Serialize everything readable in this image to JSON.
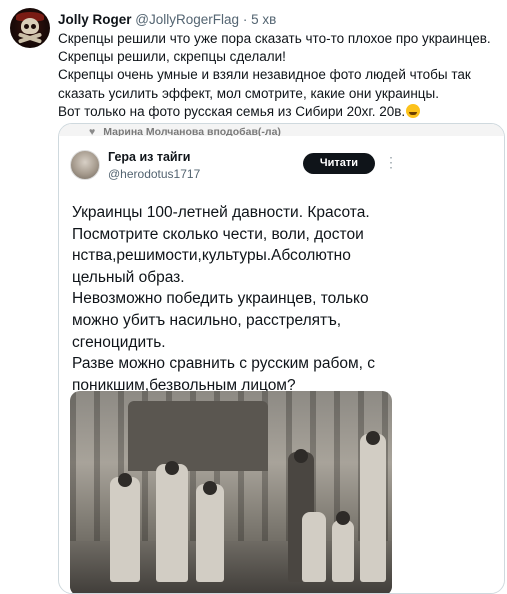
{
  "tweet": {
    "author_name": "Jolly Roger",
    "author_handle": "@JollyRogerFlag",
    "separator": "·",
    "time": "5 хв",
    "lines": [
      "Скрепцы решили что уже пора сказать что-то плохое про украинцев.",
      "Скрепцы решили, скрепцы сделали!",
      "Скрепцы очень умные и взяли незавидное фото людей чтобы так",
      "сказать усилить эффект, мол смотрите, какие они украинцы.",
      "Вот только на фото русская семья из Сибири 20хг. 20в."
    ],
    "emoji": "sweat-smile-emoji"
  },
  "embedded": {
    "retweet_context": "Марина Молчанова вподобав(-ла)",
    "author_name": "Гера из тайги",
    "author_handle": "@herodotus1717",
    "follow_label": "Читати",
    "more_icon": "more-vertical-icon",
    "text_lines": [
      "Украинцы 100-летней давности. Красота.",
      "Посмотрите сколько чести, воли, достои",
      "нства,решимости,культуры.Абсолютно",
      "цельный образ.",
      "Невозможно победить украинцев, только",
      "можно убитъ насильно, расстрелятъ,",
      "сгеноцидить.",
      "Разве можно сравнить с русским рабом, с",
      "поникшим,безвольным лицом?"
    ]
  }
}
